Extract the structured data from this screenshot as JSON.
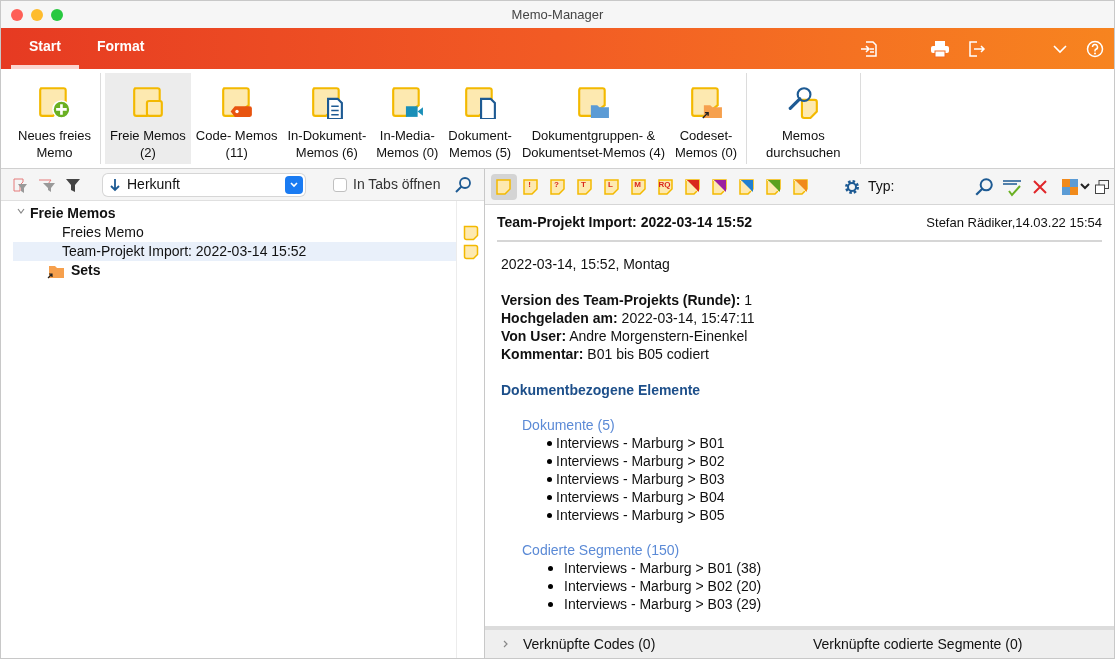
{
  "window": {
    "title": "Memo-Manager"
  },
  "ribbon_tabs": [
    {
      "label": "Start",
      "selected": true
    },
    {
      "label": "Format",
      "selected": false
    }
  ],
  "ribbon_groups": [
    [
      {
        "kind": "plus",
        "label": "Neues freies\nMemo",
        "selected": false
      }
    ],
    [
      {
        "kind": "stack",
        "label": "Freie Memos\n(2)",
        "selected": true
      },
      {
        "kind": "tag",
        "label": "Code- Memos\n(11)",
        "selected": false
      },
      {
        "kind": "document",
        "label": "In-Dokument-\nMemos (6)",
        "selected": false
      },
      {
        "kind": "video",
        "label": "In-Media-\nMemos (0)",
        "selected": false
      },
      {
        "kind": "page",
        "label": "Dokument-\nMemos (5)",
        "selected": false
      },
      {
        "kind": "folder",
        "label": "Dokumentgruppen- &\nDokumentset-Memos (4)",
        "selected": false
      },
      {
        "kind": "shortcut",
        "label": "Codeset-\nMemos (0)",
        "selected": false
      }
    ],
    [
      {
        "kind": "search",
        "label": "Memos\ndurchsuchen",
        "selected": false
      }
    ]
  ],
  "left_toolbar": {
    "sort": "Herkunft",
    "open_in_tabs": {
      "label": "In Tabs öffnen",
      "checked": false
    }
  },
  "tree": [
    {
      "label": "Freie Memos",
      "kind": "group",
      "expanded": true,
      "children": [
        {
          "label": "Freies Memo",
          "kind": "memo",
          "selected": false
        },
        {
          "label": "Team-Projekt Import: 2022-03-14 15:52",
          "kind": "memo",
          "selected": true
        }
      ]
    },
    {
      "label": "Sets",
      "kind": "set"
    }
  ],
  "memo_types": [
    {
      "kind": "plain",
      "selected": true
    },
    {
      "kind": "letter",
      "text": "!",
      "selected": false
    },
    {
      "kind": "letter",
      "text": "?",
      "selected": false
    },
    {
      "kind": "letter",
      "text": "T",
      "selected": false
    },
    {
      "kind": "letter",
      "text": "L",
      "selected": false
    },
    {
      "kind": "letter",
      "text": "M",
      "selected": false
    },
    {
      "kind": "letter",
      "text": "RQ",
      "selected": false
    },
    {
      "kind": "corner",
      "color": "#d9261c",
      "selected": false
    },
    {
      "kind": "corner",
      "color": "#9b1fa0",
      "selected": false
    },
    {
      "kind": "corner",
      "color": "#1f7fd0",
      "selected": false
    },
    {
      "kind": "corner",
      "color": "#5aa01e",
      "selected": false
    },
    {
      "kind": "corner",
      "color": "#f08a1c",
      "selected": false
    }
  ],
  "type_label": "Typ:",
  "memo": {
    "title": "Team-Projekt Import: 2022-03-14 15:52",
    "author": "Stefan Rädiker,14.03.22 15:54",
    "date_line": "2022-03-14, 15:52, Montag",
    "facts": [
      "**Version des Team-Projekts (Runde):** 1",
      "**Hochgeladen am:** 2022-03-14, 15:47:11",
      "**Von User:** Andre Morgenstern-Einenkel",
      "**Kommentar:** B01 bis B05 codiert"
    ],
    "heading": "Dokumentbezogene Elemente",
    "sections": [
      {
        "title": "Dokumente (5)",
        "kind": "tight",
        "items": [
          "Interviews - Marburg > B01",
          "Interviews - Marburg > B02",
          "Interviews - Marburg > B03",
          "Interviews - Marburg > B04",
          "Interviews - Marburg > B05"
        ]
      },
      {
        "title": "Codierte Segmente (150)",
        "kind": "wide",
        "items": [
          "Interviews - Marburg > B01 (38)",
          "Interviews - Marburg > B02 (20)",
          "Interviews - Marburg > B03 (29)"
        ]
      }
    ]
  },
  "bottom_bar": {
    "expanded": false,
    "linked_codes": "Verknüpfte Codes (0)",
    "linked_segments": "Verknüpfte codierte Segmente (0)"
  }
}
